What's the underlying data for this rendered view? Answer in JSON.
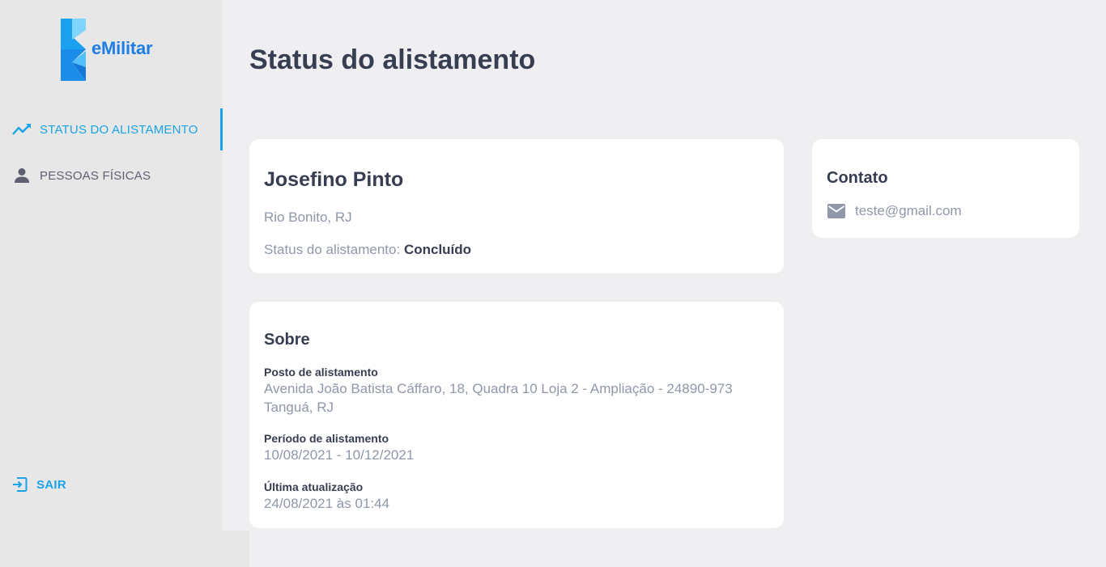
{
  "app": {
    "brand": "eMilitar",
    "accent_color": "#1aa3e8",
    "logo_color": "#1e7ee3"
  },
  "sidebar": {
    "items": [
      {
        "label": "STATUS DO ALISTAMENTO",
        "icon": "trending-up-icon",
        "active": true
      },
      {
        "label": "PESSOAS FÍSICAS",
        "icon": "person-icon",
        "active": false
      }
    ],
    "logout": {
      "label": "SAIR",
      "icon": "logout-icon"
    }
  },
  "page": {
    "title": "Status do alistamento"
  },
  "person_card": {
    "name": "Josefino Pinto",
    "location": "Rio Bonito, RJ",
    "status_label": "Status do alistamento:",
    "status_value": "Concluído"
  },
  "contact_card": {
    "title": "Contato",
    "email_icon": "mail-icon",
    "email": "teste@gmail.com"
  },
  "about_card": {
    "title": "Sobre",
    "fields": [
      {
        "label": "Posto de alistamento",
        "value_line1": "Avenida João Batista Cáffaro, 18, Quadra 10 Loja 2 - Ampliação - 24890-973",
        "value_line2": "Tanguá, RJ"
      },
      {
        "label": "Período de alistamento",
        "value": "10/08/2021 - 10/12/2021"
      },
      {
        "label": "Última atualização",
        "value": "24/08/2021 às 01:44"
      }
    ]
  }
}
